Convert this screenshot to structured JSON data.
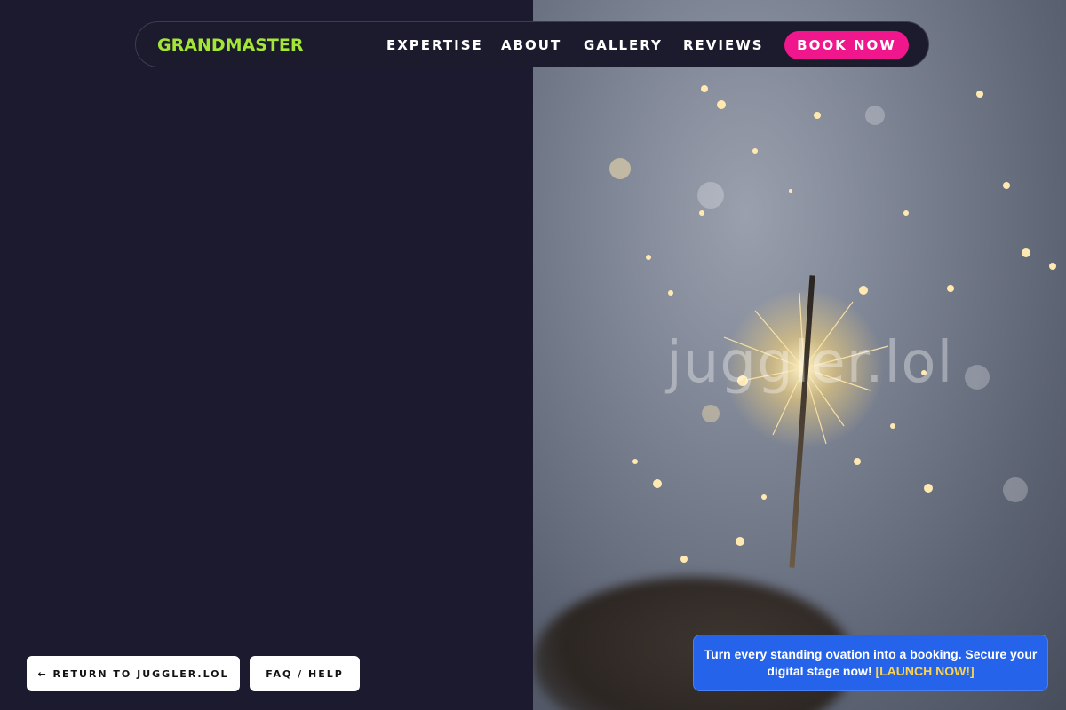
{
  "nav": {
    "brand": "GRANDMASTER",
    "links": [
      "EXPERTISE",
      "ABOUT",
      "GALLERY",
      "REVIEWS"
    ],
    "cta": "BOOK NOW"
  },
  "hero": {
    "watermark": "juggler.lol"
  },
  "footer": {
    "return_label": "← RETURN TO JUGGLER.LOL",
    "faq_label": "FAQ / HELP"
  },
  "promo": {
    "text": "Turn every standing ovation into a booking. Secure your digital stage now!",
    "link": "[LAUNCH NOW!]"
  },
  "colors": {
    "background": "#1b1a2e",
    "brand": "#a3e635",
    "cta": "#f0168b",
    "promo": "#2563eb",
    "promo_link": "#fcd34d"
  }
}
